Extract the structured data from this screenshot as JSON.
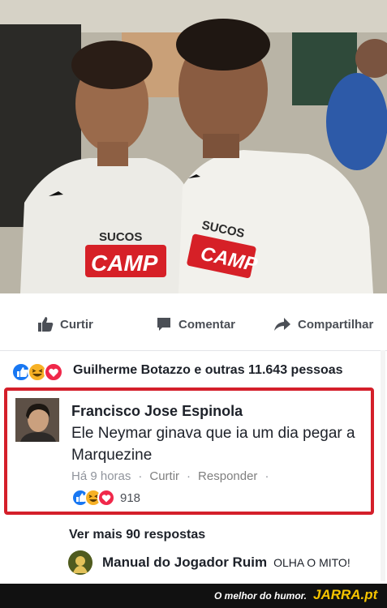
{
  "post": {
    "photo_icon": "photo-two-players",
    "shirt_brand_left": "SUCOS",
    "shirt_logo_left": "CAMP",
    "shirt_brand_right": "SUCOS",
    "shirt_logo_right": "CAMP"
  },
  "actions": {
    "like_label": "Curtir",
    "comment_label": "Comentar",
    "share_label": "Compartilhar"
  },
  "reactions": {
    "icons": [
      "like-icon",
      "haha-icon",
      "love-icon"
    ],
    "summary": "Guilherme Botazzo e outras 11.643 pessoas"
  },
  "comment": {
    "author": "Francisco Jose Espinola",
    "text": "Ele Neymar ginava que ia um dia pegar a Marquezine",
    "time": "Há 9 horas",
    "like_label": "Curtir",
    "reply_label": "Responder",
    "reaction_count": "918"
  },
  "replies": {
    "more_label": "Ver mais 90 respostas",
    "reply_author": "Manual do Jogador Ruim",
    "reply_text": "OLHA O MITO!"
  },
  "footer": {
    "tagline": "O melhor do humor.",
    "logo": "JARRA.pt"
  },
  "colors": {
    "highlight_border": "#d41f2a",
    "like_blue": "#1877f2",
    "love_red": "#f0284a",
    "haha_yellow": "#f7b125",
    "footer_logo": "#f5c400"
  }
}
